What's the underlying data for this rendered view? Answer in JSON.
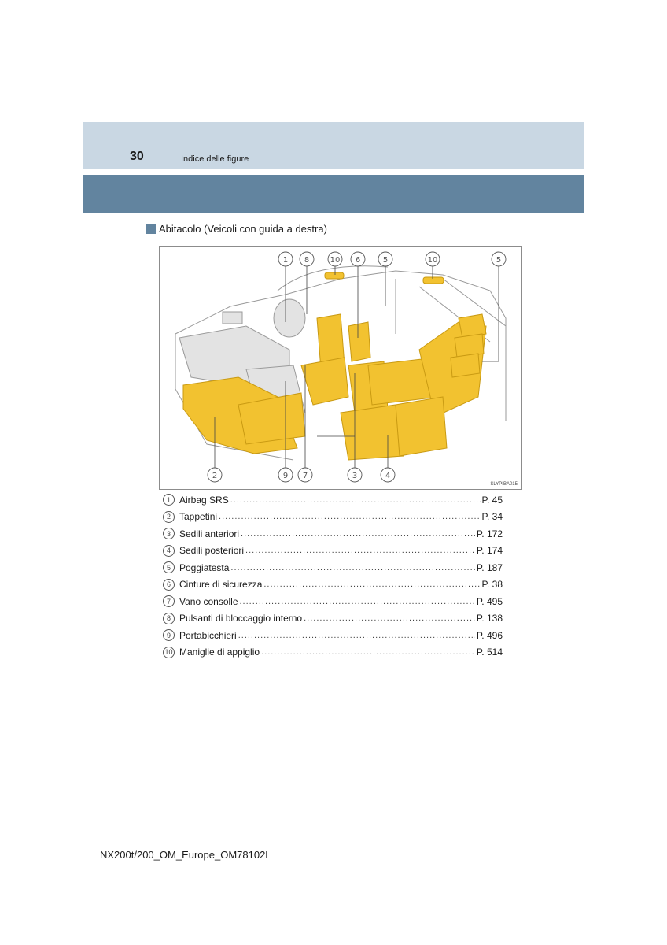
{
  "header": {
    "page_number": "30",
    "section_title": "Indice delle figure"
  },
  "sub_heading": "Abitacolo (Veicoli con guida a destra)",
  "figure": {
    "code": "SLYPIBA015",
    "callouts_top": [
      "1",
      "8",
      "10",
      "6",
      "5",
      "10",
      "5"
    ],
    "callouts_bottom": [
      "2",
      "9",
      "7",
      "3",
      "4"
    ]
  },
  "items": [
    {
      "num": "1",
      "label": "Airbag SRS",
      "page": "P. 45"
    },
    {
      "num": "2",
      "label": "Tappetini",
      "page": "P. 34"
    },
    {
      "num": "3",
      "label": "Sedili anteriori",
      "page": "P. 172"
    },
    {
      "num": "4",
      "label": "Sedili posteriori",
      "page": "P. 174"
    },
    {
      "num": "5",
      "label": "Poggiatesta",
      "page": "P. 187"
    },
    {
      "num": "6",
      "label": "Cinture di sicurezza",
      "page": "P. 38"
    },
    {
      "num": "7",
      "label": "Vano consolle",
      "page": "P. 495"
    },
    {
      "num": "8",
      "label": "Pulsanti di bloccaggio interno",
      "page": "P. 138"
    },
    {
      "num": "9",
      "label": "Portabicchieri",
      "page": "P. 496"
    },
    {
      "num": "10",
      "label": "Maniglie di appiglio",
      "page": "P. 514"
    }
  ],
  "footer": {
    "doc_code": "NX200t/200_OM_Europe_OM78102L"
  },
  "colors": {
    "header_light": "#c9d7e3",
    "header_dark": "#62849f",
    "highlight_yellow": "#f2c230"
  }
}
